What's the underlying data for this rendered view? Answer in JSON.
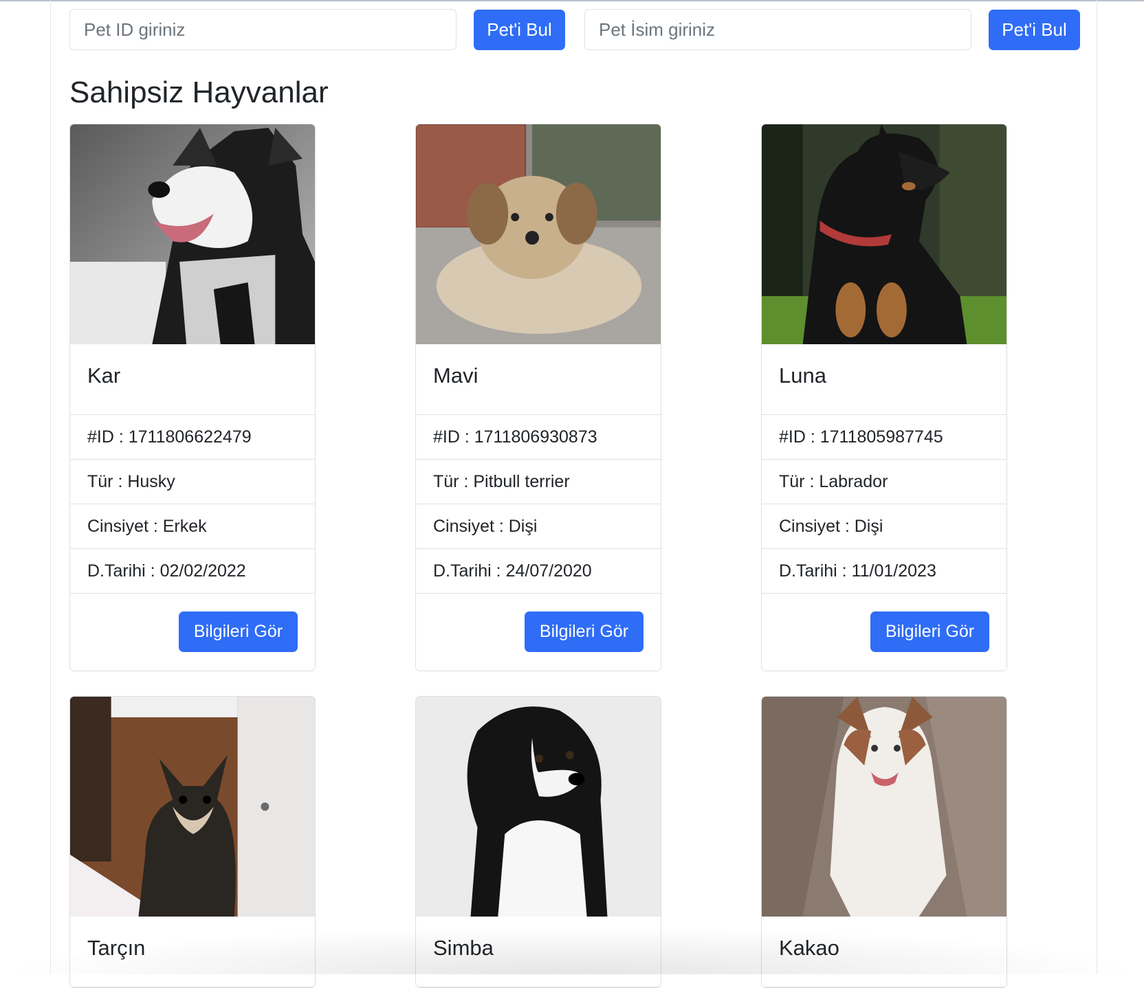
{
  "search": {
    "id_placeholder": "Pet ID giriniz",
    "id_button": "Pet'i Bul",
    "name_placeholder": "Pet İsim giriniz",
    "name_button": "Pet'i Bul"
  },
  "page_title": "Sahipsiz Hayvanlar",
  "pets": [
    {
      "name": "Kar",
      "id": "#ID : 1711806622479",
      "type": "Tür : Husky",
      "gender": "Cinsiyet : Erkek",
      "birth": "D.Tarihi : 02/02/2022",
      "button": "Bilgileri Gör"
    },
    {
      "name": "Mavi",
      "id": "#ID : 1711806930873",
      "type": "Tür : Pitbull terrier",
      "gender": "Cinsiyet : Dişi",
      "birth": "D.Tarihi : 24/07/2020",
      "button": "Bilgileri Gör"
    },
    {
      "name": "Luna",
      "id": "#ID : 1711805987745",
      "type": "Tür : Labrador",
      "gender": "Cinsiyet : Dişi",
      "birth": "D.Tarihi : 11/01/2023",
      "button": "Bilgileri Gör"
    },
    {
      "name": "Tarçın"
    },
    {
      "name": "Simba"
    },
    {
      "name": "Kakao"
    }
  ],
  "colors": {
    "primary": "#2f6df6",
    "border": "#dcdfe3",
    "text": "#212529"
  }
}
